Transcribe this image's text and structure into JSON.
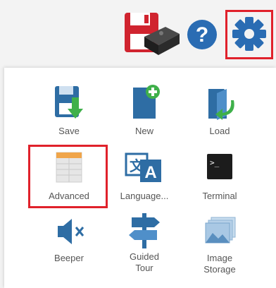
{
  "toolbar": {
    "icons": [
      "save-device-icon",
      "help-icon",
      "gear-icon"
    ],
    "help_glyph": "?"
  },
  "menu": {
    "items": [
      {
        "label": "Save",
        "icon": "save-icon"
      },
      {
        "label": "New",
        "icon": "new-icon"
      },
      {
        "label": "Load",
        "icon": "load-icon"
      },
      {
        "label": "Advanced",
        "icon": "advanced-icon"
      },
      {
        "label": "Language...",
        "icon": "language-icon"
      },
      {
        "label": "Terminal",
        "icon": "terminal-icon"
      },
      {
        "label": "Beeper",
        "icon": "beeper-icon"
      },
      {
        "label": "Guided\nTour",
        "icon": "guided-tour-icon"
      },
      {
        "label": "Image\nStorage",
        "icon": "image-storage-icon"
      }
    ]
  },
  "glyphs": {
    "language_left": "文",
    "language_right": "A",
    "terminal_prompt": ">_"
  },
  "colors": {
    "highlight": "#e0212b",
    "accent_blue": "#2e6da4",
    "accent_green": "#3fb04a"
  }
}
